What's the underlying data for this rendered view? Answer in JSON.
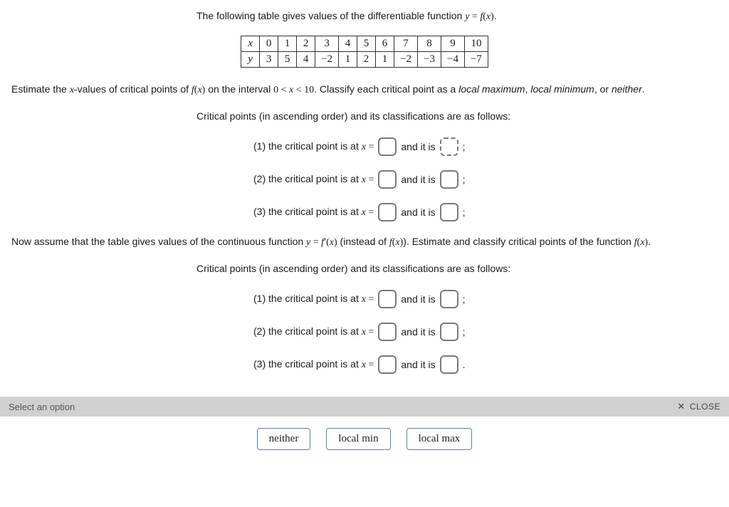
{
  "intro": {
    "prefix": "The following table gives values of the differentiable function ",
    "func_lhs": "y",
    "eq": " = ",
    "func_rhs_f": "f",
    "func_rhs_x": "x",
    "suffix": "."
  },
  "table": {
    "row_x_label": "x",
    "row_y_label": "y",
    "x": [
      "0",
      "1",
      "2",
      "3",
      "4",
      "5",
      "6",
      "7",
      "8",
      "9",
      "10"
    ],
    "y": [
      "3",
      "5",
      "4",
      "−2",
      "1",
      "2",
      "1",
      "−2",
      "−3",
      "−4",
      "−7"
    ]
  },
  "prompt1": {
    "a": "Estimate the ",
    "xvar": "x",
    "b": "-values of critical points of ",
    "fx_f": "f",
    "fx_x": "x",
    "c": " on the interval ",
    "ineq": "0 < x < 10",
    "d": ". Classify each critical point as a ",
    "lm": "local maximum",
    "comma": ", ",
    "lmin": "local minimum",
    "or": ", or ",
    "nei": "neither",
    "end": "."
  },
  "subhead1": "Critical points (in ascending order) and its classifications are as follows:",
  "cp_rows1": [
    {
      "idx": "(1)",
      "text": "the critical point is at ",
      "xvar": "x",
      "eq": " = ",
      "mid": "and it is",
      "trail": ";",
      "focused": true
    },
    {
      "idx": "(2)",
      "text": "the critical point is at ",
      "xvar": "x",
      "eq": " = ",
      "mid": "and it is",
      "trail": ";",
      "focused": false
    },
    {
      "idx": "(3)",
      "text": "the critical point is at ",
      "xvar": "x",
      "eq": " = ",
      "mid": "and it is",
      "trail": ";",
      "focused": false
    }
  ],
  "prompt2": {
    "a": "Now assume that the table gives values of the continuous function ",
    "y": "y",
    "eq": " = ",
    "fprime_f": "f",
    "fprime_x": "x",
    "b": " (instead of ",
    "fx_f": "f",
    "fx_x": "x",
    "c": "). Estimate and classify critical points of the function ",
    "fx2_f": "f",
    "fx2_x": "x",
    "d": "."
  },
  "subhead2": "Critical points (in ascending order) and its classifications are as follows:",
  "cp_rows2": [
    {
      "idx": "(1)",
      "text": "the critical point is at ",
      "xvar": "x",
      "eq": " = ",
      "mid": "and it is",
      "trail": ";"
    },
    {
      "idx": "(2)",
      "text": "the critical point is at ",
      "xvar": "x",
      "eq": " = ",
      "mid": "and it is",
      "trail": ";"
    },
    {
      "idx": "(3)",
      "text": "the critical point is at ",
      "xvar": "x",
      "eq": " = ",
      "mid": "and it is",
      "trail": "."
    }
  ],
  "footer": {
    "placeholder": "Select an option",
    "close": "CLOSE"
  },
  "options": [
    "neither",
    "local min",
    "local max"
  ]
}
